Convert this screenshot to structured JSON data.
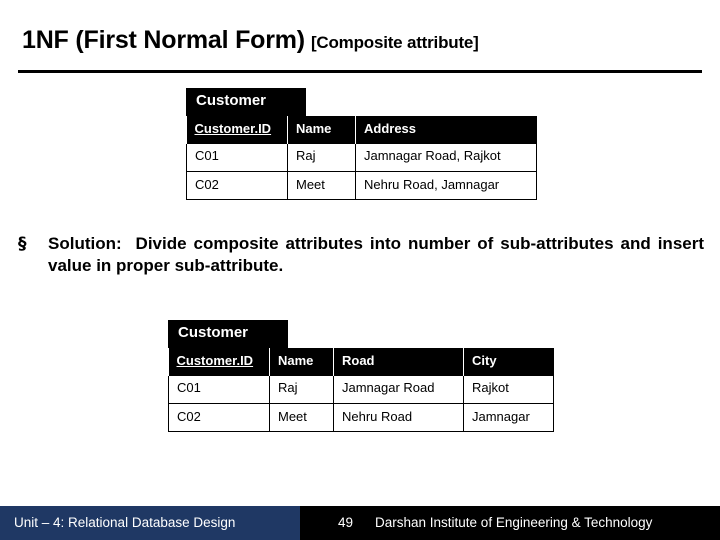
{
  "slide": {
    "title_main": "1NF (First Normal Form)",
    "title_sub": "[Composite attribute]"
  },
  "table_top": {
    "caption": "Customer",
    "headers": [
      "Customer.ID",
      "Name",
      "Address"
    ],
    "rows": [
      [
        "C01",
        "Raj",
        "Jamnagar Road, Rajkot"
      ],
      [
        "C02",
        "Meet",
        "Nehru Road, Jamnagar"
      ]
    ]
  },
  "solution": {
    "bullet": "§",
    "label": "Solution:",
    "emphasis": "Divide composite attributes",
    "mid": "into",
    "emphasis2": "number of sub-attributes",
    "tail": "and insert value in proper sub-attribute."
  },
  "table_bottom": {
    "caption": "Customer",
    "headers": [
      "Customer.ID",
      "Name",
      "Road",
      "City"
    ],
    "rows": [
      [
        "C01",
        "Raj",
        "Jamnagar Road",
        "Rajkot"
      ],
      [
        "C02",
        "Meet",
        "Nehru Road",
        "Jamnagar"
      ]
    ]
  },
  "footer": {
    "unit": "Unit – 4: Relational Database Design",
    "page": "49",
    "institute": "Darshan Institute of Engineering & Technology",
    "left_color": "#1f3864",
    "right_color": "#000000"
  }
}
